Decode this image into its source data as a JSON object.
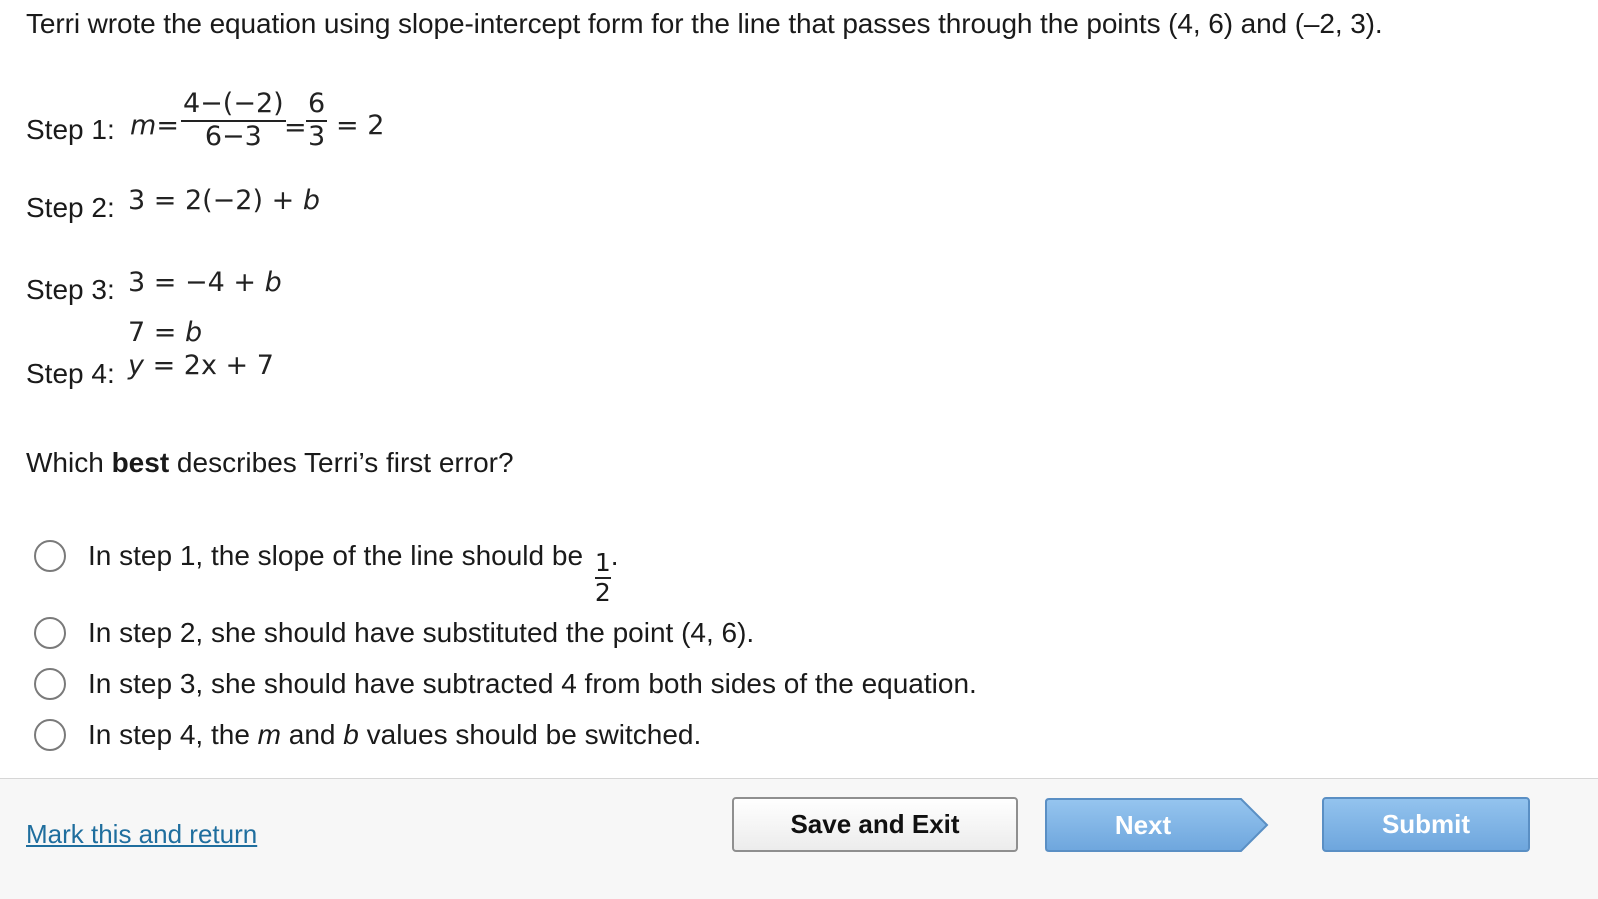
{
  "prompt": "Terri wrote the equation using slope-intercept form for the line that passes through the points (4, 6) and (–2, 3).",
  "steps": {
    "step1": {
      "label": "Step 1:",
      "m": "m",
      "eq": "=",
      "frac1_num": "4−(−2)",
      "frac1_den": "6−3",
      "eq2": "=",
      "frac2_num": "6",
      "frac2_den": "3",
      "result": "= 2"
    },
    "step2": {
      "label": "Step 2:",
      "expr_a": "3 = 2(−2) + ",
      "expr_b": "b"
    },
    "step3": {
      "label": "Step 3:",
      "line1_a": "3 = −4 + ",
      "line1_b": "b",
      "line2_a": "7 = ",
      "line2_b": "b"
    },
    "step4": {
      "label": "Step 4:",
      "expr_a": "y",
      "expr_b": " = 2x + 7"
    }
  },
  "question": {
    "pre": "Which ",
    "bold": "best",
    "post": " describes Terri’s first error?"
  },
  "options": [
    {
      "text": "In step 1, the slope of the line should be",
      "frac_num": "1",
      "frac_den": "2",
      "suffix": "."
    },
    {
      "text": "In step 2, she should have substituted the point (4, 6)."
    },
    {
      "text": "In step 3, she should have subtracted 4 from both sides of the equation."
    },
    {
      "pre": "In step 4, the ",
      "m": "m",
      "mid": " and ",
      "b": "b",
      "post": " values should be switched."
    }
  ],
  "footer": {
    "mark_link": "Mark this and return",
    "save_exit": "Save and Exit",
    "next": "Next",
    "submit": "Submit"
  },
  "colors": {
    "link": "#1f6e9e",
    "next_fill": "#7fb2e5",
    "submit_fill": "#7eb1e4",
    "radio_border": "#7a7a7a"
  }
}
